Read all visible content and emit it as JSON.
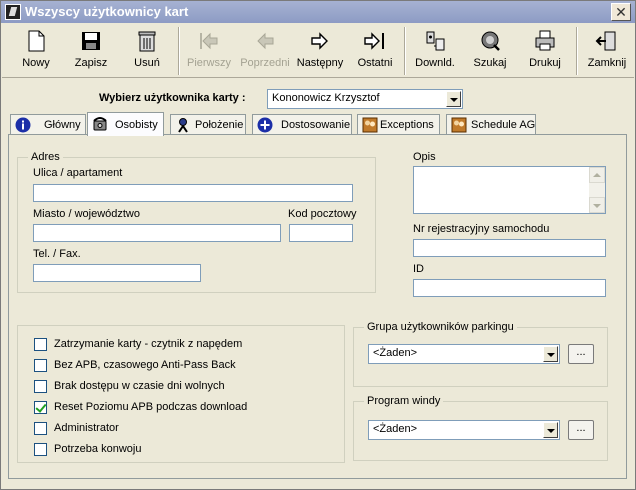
{
  "window": {
    "title": "Wszyscy użytkownicy kart",
    "close_glyph": "✕"
  },
  "toolbar": {
    "buttons": [
      {
        "label": "Nowy",
        "icon": "new-document-icon",
        "enabled": true
      },
      {
        "label": "Zapisz",
        "icon": "floppy-disk-icon",
        "enabled": true
      },
      {
        "label": "Usuń",
        "icon": "trash-can-icon",
        "enabled": true
      },
      {
        "label": "Pierwszy",
        "icon": "first-record-icon",
        "enabled": false
      },
      {
        "label": "Poprzedni",
        "icon": "previous-record-icon",
        "enabled": false
      },
      {
        "label": "Następny",
        "icon": "next-record-icon",
        "enabled": true
      },
      {
        "label": "Ostatni",
        "icon": "last-record-icon",
        "enabled": true
      },
      {
        "label": "Downld.",
        "icon": "download-icon",
        "enabled": true
      },
      {
        "label": "Szukaj",
        "icon": "search-icon",
        "enabled": true
      },
      {
        "label": "Drukuj",
        "icon": "printer-icon",
        "enabled": true
      },
      {
        "label": "Zamknij",
        "icon": "exit-door-icon",
        "enabled": true
      }
    ]
  },
  "user_select": {
    "label": "Wybierz użytkownika karty :",
    "value": "Kononowicz Krzysztof"
  },
  "tabs": [
    {
      "label": "Główny",
      "icon": "info-icon"
    },
    {
      "label": "Osobisty",
      "icon": "phone-icon",
      "active": true
    },
    {
      "label": "Położenie",
      "icon": "person-search-icon"
    },
    {
      "label": "Dostosowanie",
      "icon": "plus-circle-icon"
    },
    {
      "label": "Exceptions",
      "icon": "people-icon"
    },
    {
      "label": "Schedule AG",
      "icon": "people-icon"
    }
  ],
  "address": {
    "title": "Adres",
    "street_label": "Ulica / apartament",
    "city_label": "Miasto / województwo",
    "zip_label": "Kod pocztowy",
    "phone_label": "Tel. / Fax.",
    "street_value": "",
    "city_value": "",
    "zip_value": "",
    "phone_value": ""
  },
  "right_fields": {
    "description_label": "Opis",
    "car_reg_label": "Nr rejestracyjny samochodu",
    "id_label": "ID",
    "description_value": "",
    "car_reg_value": "",
    "id_value": ""
  },
  "options": [
    {
      "label": "Zatrzymanie karty - czytnik z napędem",
      "checked": false
    },
    {
      "label": "Bez APB, czasowego Anti-Pass Back",
      "checked": false
    },
    {
      "label": "Brak dostępu w czasie dni wolnych",
      "checked": false
    },
    {
      "label": "Reset Poziomu APB podczas download",
      "checked": true
    },
    {
      "label": "Administrator",
      "checked": false
    },
    {
      "label": "Potrzeba konwoju",
      "checked": false
    }
  ],
  "parking_group": {
    "title": "Grupa użytkowników parkingu",
    "value": "<Żaden>",
    "browse_label": "..."
  },
  "elevator_program": {
    "title": "Program windy",
    "value": "<Żaden>",
    "browse_label": "..."
  }
}
